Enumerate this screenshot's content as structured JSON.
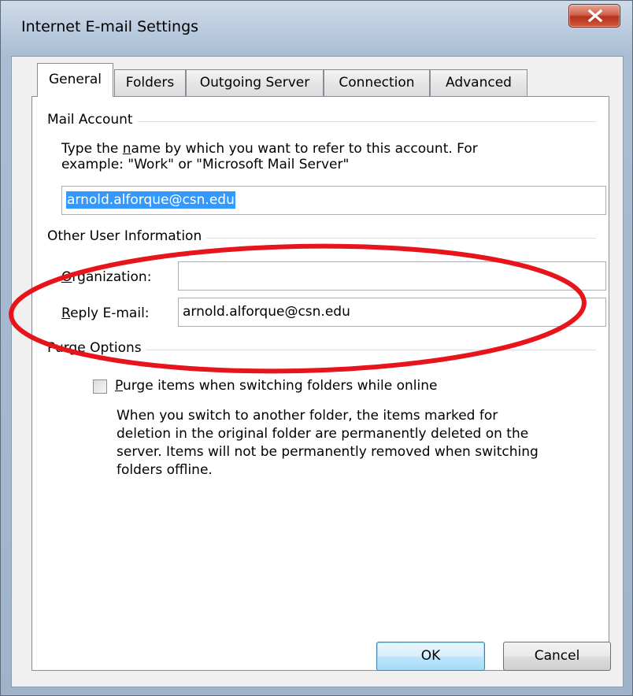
{
  "window": {
    "title": "Internet E-mail Settings",
    "close_icon": "close-icon"
  },
  "tabs": [
    {
      "label": "General",
      "active": true
    },
    {
      "label": "Folders",
      "active": false
    },
    {
      "label": "Outgoing Server",
      "active": false
    },
    {
      "label": "Connection",
      "active": false
    },
    {
      "label": "Advanced",
      "active": false
    }
  ],
  "mail_account": {
    "title": "Mail Account",
    "description_line1_pre": "Type the ",
    "description_line1_u": "n",
    "description_line1_post": "ame by which you want to refer to this account. For",
    "description_line2": "example: \"Work\" or \"Microsoft Mail Server\"",
    "account_name_value": "arnold.alforque@csn.edu"
  },
  "other_user_info": {
    "title": "Other User Information",
    "organization_label_u": "O",
    "organization_label_rest": "rganization:",
    "organization_value": "",
    "reply_label_u": "R",
    "reply_label_rest": "eply E-mail:",
    "reply_value": "arnold.alforque@csn.edu"
  },
  "purge_options": {
    "title": "Purge Options",
    "checkbox_label_u": "P",
    "checkbox_label_rest": "urge items when switching folders while online",
    "checked": false,
    "description": [
      "When you switch to another folder, the items marked for",
      "deletion in the original folder are permanently deleted on the",
      "server. Items will not be permanently removed when switching",
      "folders offline."
    ]
  },
  "buttons": {
    "ok": "OK",
    "cancel": "Cancel"
  },
  "colors": {
    "annotation_ellipse": "#e8141b",
    "selection": "#3399ff",
    "close_button": "#c8442e"
  }
}
